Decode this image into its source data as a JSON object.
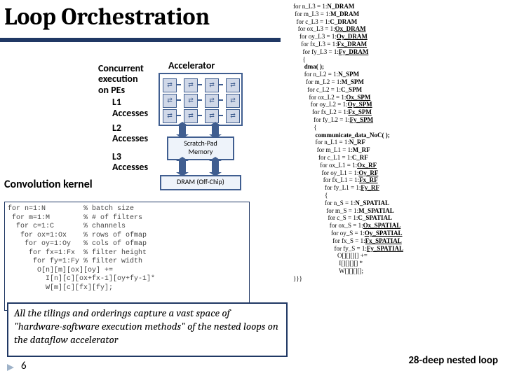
{
  "title": "Loop Orchestration",
  "labels": {
    "concurrent": "Concurrent\nexecution\non PEs",
    "l1": "L1\nAccesses",
    "l2": "L2\nAccesses",
    "l3": "L3\nAccesses",
    "accelerator": "Accelerator",
    "spm": "Scratch-Pad\nMemory",
    "dram": "DRAM (Off-Chip)"
  },
  "conv_label": "Convolution kernel",
  "conv_code": "for n=1:N         % batch size\n for m=1:M        % # of filters\n  for c=1:C       % channels\n   for ox=1:Ox    % rows of ofmap\n    for oy=1:Oy   % cols of ofmap\n     for fx=1:Fx  % filter height\n      for fy=1:Fy % filter width\n       O[n][m][ox][oy] +=\n         I[n][c][ox+fx-1][oy+fy-1]*\n         W[m][c][fx][fy];",
  "callout": "All the tilings and orderings capture a vast space of \"hardware-software execution methods\" of the nested loops on the dataflow accelerator",
  "right_code": [
    {
      "i": 0,
      "t": "for n_L3 = 1:<b>N_DRAM</b>"
    },
    {
      "i": 1,
      "t": "for m_L3 = 1:<b>M_DRAM</b>"
    },
    {
      "i": 2,
      "t": "for c_L3 = 1:<b>C_DRAM</b>"
    },
    {
      "i": 3,
      "t": "for ox_L3 = 1:<b><span class=\"u\">Ox_DRAM</span></b>"
    },
    {
      "i": 4,
      "t": "for oy_L3 = 1:<b><span class=\"u\">Oy_DRAM</span></b>"
    },
    {
      "i": 5,
      "t": "for fx_L3 = 1:<b><span class=\"u\">Fx_DRAM</span></b>"
    },
    {
      "i": 6,
      "t": "for fy_L3 = 1:<b><span class=\"u\">Fy_DRAM</span></b>"
    },
    {
      "i": 6,
      "t": "{"
    },
    {
      "i": 7,
      "t": "<b>dma( );</b>"
    },
    {
      "i": 7,
      "t": "for n_L2 = 1:<b>N_SPM</b>"
    },
    {
      "i": 8,
      "t": "for m_L2 = 1:<b>M_SPM</b>"
    },
    {
      "i": 9,
      "t": "for c_L2 = 1:<b>C_SPM</b>"
    },
    {
      "i": 10,
      "t": "for ox_L2 = 1:<b><span class=\"u\">Ox_SPM</span></b>"
    },
    {
      "i": 11,
      "t": "for oy_L2 = 1:<b><span class=\"u\">Oy_SPM</span></b>"
    },
    {
      "i": 12,
      "t": "for fx_L2 = 1:<b><span class=\"u\">Fx_SPM</span></b>"
    },
    {
      "i": 13,
      "t": "for fy_L2 = 1:<b><span class=\"u\">Fy_SPM</span></b>"
    },
    {
      "i": 13,
      "t": "{"
    },
    {
      "i": 14,
      "t": "<b>communicate_data_NoC( );</b>"
    },
    {
      "i": 14,
      "t": "for n_L1 = 1:<b>N_RF</b>"
    },
    {
      "i": 15,
      "t": "for m_L1 = 1:<b>M_RF</b>"
    },
    {
      "i": 16,
      "t": "for c_L1 = 1:<b>C_RF</b>"
    },
    {
      "i": 17,
      "t": "for ox_L1 = 1:<b><span class=\"u\">Ox_RF</span></b>"
    },
    {
      "i": 18,
      "t": "for oy_L1 = 1:<b><span class=\"u\">Oy_RF</span></b>"
    },
    {
      "i": 19,
      "t": "for fx_L1 = 1:<b><span class=\"u\">Fx_RF</span></b>"
    },
    {
      "i": 20,
      "t": "for fy_L1 = 1:<b><span class=\"u\">Fy_RF</span></b>"
    },
    {
      "i": 20,
      "t": "{"
    },
    {
      "i": 20,
      "t": "for n_S = 1:<b>N_SPATIAL</b>"
    },
    {
      "i": 21,
      "t": "for m_S = 1:<b>M_SPATIAL</b>"
    },
    {
      "i": 22,
      "t": "for c_S = 1:<b>C_SPATIAL</b>"
    },
    {
      "i": 23,
      "t": "for ox_S = 1:<b><span class=\"u\">Ox_SPATIAL</span></b>"
    },
    {
      "i": 24,
      "t": "for oy_S = 1:<b><span class=\"u\">Oy_SPATIAL</span></b>"
    },
    {
      "i": 25,
      "t": "for fx_S = 1:<b><span class=\"u\">Fx_SPATIAL</span></b>"
    },
    {
      "i": 26,
      "t": "for fy_S = 1:<b><span class=\"u\">Fy_SPATIAL</span></b>"
    },
    {
      "i": 28,
      "t": "O[][][][] +="
    },
    {
      "i": 29,
      "t": "I[][][][] *"
    },
    {
      "i": 29,
      "t": "W[][][][];"
    },
    {
      "i": 0,
      "t": "}}}"
    }
  ],
  "footer_label": "28-deep nested loop",
  "page_num": "6"
}
